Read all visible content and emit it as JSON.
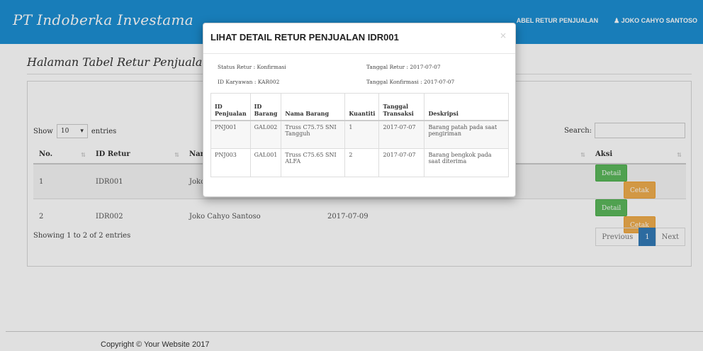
{
  "navbar": {
    "brand": "PT Indoberka Investama",
    "links": [
      "ABEL RETUR PENJUALAN",
      "JOKO CAHYO SANTOSO"
    ]
  },
  "page": {
    "title": "Halaman Tabel Retur Penjualan"
  },
  "table_controls": {
    "show_label": "Show",
    "page_length": "10",
    "entries_label": "entries",
    "search_label": "Search:"
  },
  "main_table": {
    "headers": [
      "No.",
      "ID Retur",
      "Nama",
      "",
      "",
      "Aksi"
    ],
    "rows": [
      {
        "no": "1",
        "id_retur": "IDR001",
        "nama": "Joko C",
        "tanggal": "",
        "status": ""
      },
      {
        "no": "2",
        "id_retur": "IDR002",
        "nama": "Joko Cahyo Santoso",
        "tanggal": "2017-07-09",
        "status": ""
      }
    ],
    "detail_label": "Detail",
    "cetak_label": "Cetak"
  },
  "pagination": {
    "info": "Showing 1 to 2 of 2 entries",
    "previous": "Previous",
    "current": "1",
    "next": "Next"
  },
  "footer": {
    "copyright": "Copyright © Your Website 2017"
  },
  "modal": {
    "title": "LIHAT DETAIL RETUR PENJUALAN IDR001",
    "close": "×",
    "status_retur": "Status Retur : Konfirmasi",
    "tanggal_retur": "Tanggal Retur : 2017-07-07",
    "id_karyawan": "ID Karyawan : KAR002",
    "tanggal_konfirmasi": "Tanggal Konfirmasi : 2017-07-07",
    "headers": [
      "ID Penjualan",
      "ID Barang",
      "Nama Barang",
      "Kuantiti",
      "Tanggal Transaksi",
      "Deskripsi"
    ],
    "rows": [
      [
        "PNJ001",
        "GAL002",
        "Truss C75.75 SNI Tangguh",
        "1",
        "2017-07-07",
        "Barang patah pada saat pengiriman"
      ],
      [
        "PNJ003",
        "GAL001",
        "Truss C75.65 SNI ALFA",
        "2",
        "2017-07-07",
        "Barang bengkok pada saat diterima"
      ]
    ]
  },
  "colors": {
    "navbar": "#1c8fd3",
    "detail_button": "#5cb85c",
    "cetak_button": "#f0ad4e",
    "active_page": "#337ab7"
  }
}
